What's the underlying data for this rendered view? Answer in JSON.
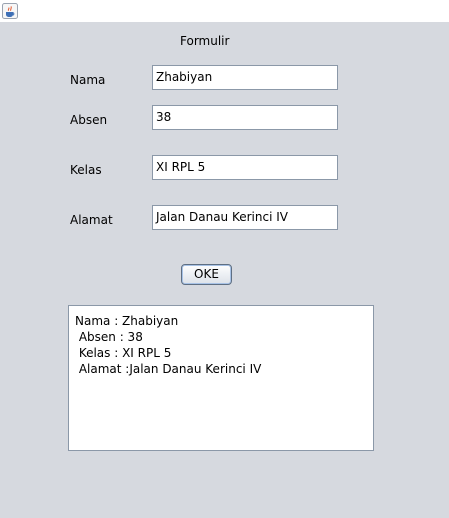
{
  "window": {
    "icon": "java-cup-icon"
  },
  "form": {
    "title": "Formulir",
    "fields": [
      {
        "label": "Nama",
        "value": "Zhabiyan"
      },
      {
        "label": "Absen",
        "value": "38"
      },
      {
        "label": "Kelas",
        "value": "XI RPL 5"
      },
      {
        "label": "Alamat",
        "value": "Jalan Danau Kerinci IV"
      }
    ],
    "submit_label": "OKE"
  },
  "output": {
    "lines": [
      "Nama : Zhabiyan",
      " Absen : 38",
      " Kelas : XI RPL 5",
      " Alamat :Jalan Danau Kerinci IV"
    ]
  }
}
